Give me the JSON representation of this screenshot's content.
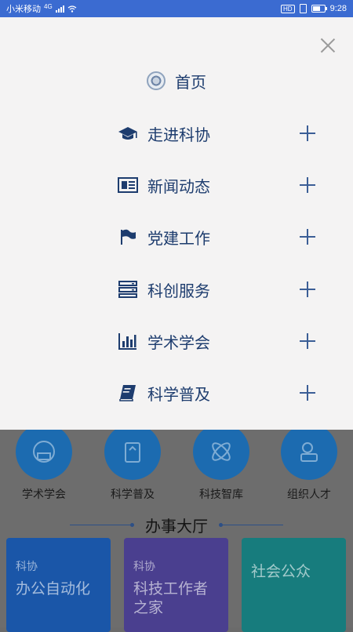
{
  "status_bar": {
    "carrier": "小米移动",
    "network": "4G",
    "time": "9:28",
    "hd": "HD",
    "battery_level": 0.7
  },
  "drawer": {
    "home_label": "首页",
    "items": [
      {
        "label": "走进科协",
        "icon": "graduation-cap-icon"
      },
      {
        "label": "新闻动态",
        "icon": "newspaper-icon"
      },
      {
        "label": "党建工作",
        "icon": "flag-icon"
      },
      {
        "label": "科创服务",
        "icon": "server-stack-icon"
      },
      {
        "label": "学术学会",
        "icon": "bar-chart-icon"
      },
      {
        "label": "科学普及",
        "icon": "book-icon"
      }
    ]
  },
  "background": {
    "features": [
      {
        "label": "学术学会"
      },
      {
        "label": "科学普及"
      },
      {
        "label": "科技智库"
      },
      {
        "label": "组织人才"
      }
    ],
    "section_title": "办事大厅",
    "cards": [
      {
        "top": "科协",
        "main": "办公自动化"
      },
      {
        "top": "科协",
        "main": "科技工作者之家"
      },
      {
        "top": "",
        "main": "社会公众"
      }
    ]
  },
  "colors": {
    "accent": "#1d3c6e",
    "status_bar": "#3b6bd1",
    "drawer_bg": "#f4f3f3"
  }
}
